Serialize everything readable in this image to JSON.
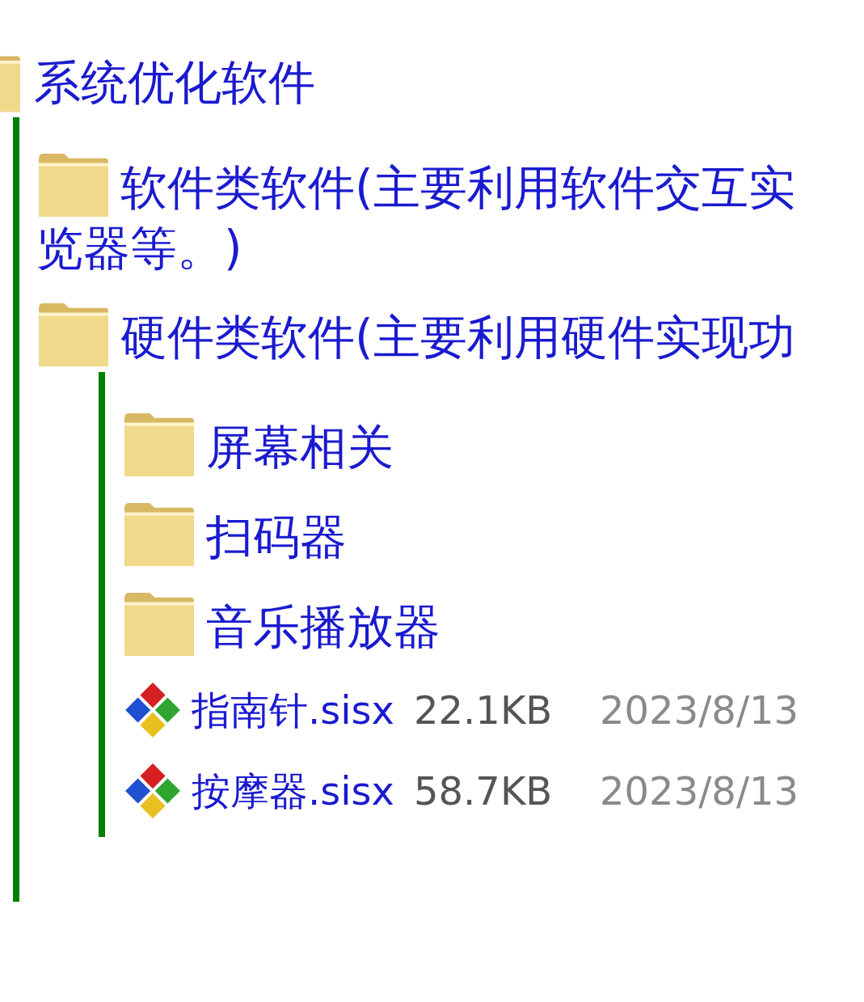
{
  "tree": {
    "kind": "folder",
    "label": "系统优化软件",
    "children": [
      {
        "kind": "folder",
        "label": "软件类软件(主要利用软件交互实",
        "label_wrap": "览器等。)"
      },
      {
        "kind": "folder",
        "label": "硬件类软件(主要利用硬件实现功",
        "children": [
          {
            "kind": "folder",
            "label": "屏幕相关"
          },
          {
            "kind": "folder",
            "label": "扫码器"
          },
          {
            "kind": "folder",
            "label": "音乐播放器"
          },
          {
            "kind": "file",
            "label": "指南针.sisx",
            "size": "22.1KB",
            "date": "2023/8/13"
          },
          {
            "kind": "file",
            "label": "按摩器.sisx",
            "size": "58.7KB",
            "date": "2023/8/13"
          }
        ]
      }
    ]
  }
}
